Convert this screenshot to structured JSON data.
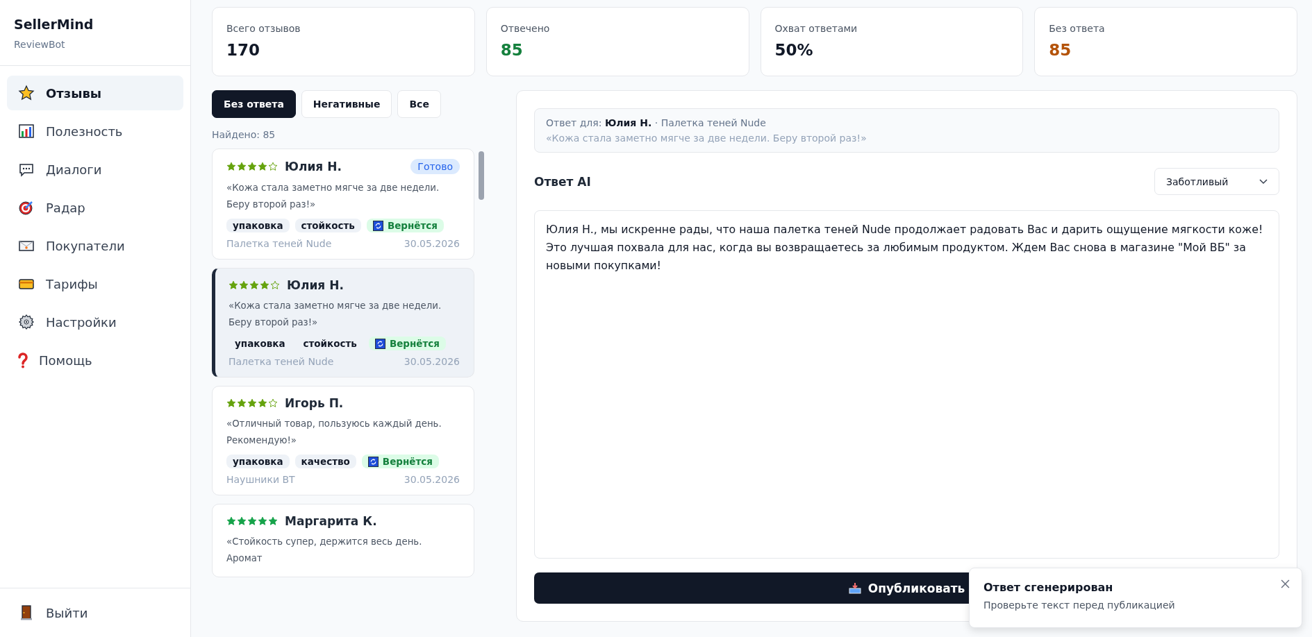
{
  "brand": {
    "title": "SellerMind",
    "subtitle": "ReviewBot"
  },
  "nav": [
    {
      "label": "Отзывы",
      "selected": true
    },
    {
      "label": "Полезность",
      "selected": false
    },
    {
      "label": "Диалоги",
      "selected": false
    },
    {
      "label": "Радар",
      "selected": false
    },
    {
      "label": "Покупатели",
      "selected": false
    },
    {
      "label": "Тарифы",
      "selected": false
    },
    {
      "label": "Настройки",
      "selected": false
    },
    {
      "label": "Помощь",
      "selected": false
    }
  ],
  "logout": {
    "label": "Выйти"
  },
  "stats": [
    {
      "label": "Всего отзывов",
      "value": "170",
      "color": "#111827"
    },
    {
      "label": "Отвечено",
      "value": "85",
      "color": "#15803d"
    },
    {
      "label": "Охват ответами",
      "value": "50%",
      "color": "#111827"
    },
    {
      "label": "Без ответа",
      "value": "85",
      "color": "#b45309"
    }
  ],
  "filters": [
    {
      "label": "Без ответа",
      "selected": true
    },
    {
      "label": "Негативные",
      "selected": false
    },
    {
      "label": "Все",
      "selected": false
    }
  ],
  "found": "Найдено: 85",
  "reviews": [
    {
      "stars": 4,
      "author": "Юлия Н.",
      "badge": "Готово",
      "quote": "«Кожа стала заметно мягче за две недели. Беру второй раз!»",
      "tags": [
        {
          "kind": "tag",
          "label": "упаковка"
        },
        {
          "kind": "tag",
          "label": "стойкость"
        },
        {
          "kind": "returning",
          "label": "Вернётся"
        }
      ],
      "product": "Палетка теней Nude",
      "date": "30.05.2026",
      "selected": false
    },
    {
      "stars": 4,
      "author": "Юлия Н.",
      "quote": "«Кожа стала заметно мягче за две недели. Беру второй раз!»",
      "tags": [
        {
          "kind": "tag",
          "label": "упаковка"
        },
        {
          "kind": "tag",
          "label": "стойкость"
        },
        {
          "kind": "returning",
          "label": "Вернётся"
        }
      ],
      "product": "Палетка теней Nude",
      "date": "30.05.2026",
      "selected": true
    },
    {
      "stars": 4,
      "author": "Игорь П.",
      "quote": "«Отличный товар, пользуюсь каждый день. Рекомендую!»",
      "tags": [
        {
          "kind": "tag",
          "label": "упаковка"
        },
        {
          "kind": "tag",
          "label": "качество"
        },
        {
          "kind": "returning",
          "label": "Вернётся"
        }
      ],
      "product": "Наушники BT",
      "date": "30.05.2026",
      "selected": false
    },
    {
      "stars": 5,
      "author": "Маргарита К.",
      "quote": "«Стойкость супер, держится весь день. Аромат",
      "selected": false
    }
  ],
  "reply": {
    "context": "Ответ для: **Юлия Н.** · Палетка теней Nude",
    "context_quote": "«Кожа стала заметно мягче за две недели. Беру второй раз!»",
    "heading": "Ответ AI",
    "tone": "Заботливый",
    "text": "Юлия Н., мы искренне рады, что наша палетка теней Nude продолжает радовать Вас и дарить ощущение мягкости коже! Это лучшая похвала для нас, когда вы возвращаетесь за любимым продуктом. Ждем Вас снова в магазине \"Мой ВБ\" за новыми покупками!",
    "publish": "Опубликовать"
  },
  "toast": {
    "title": "Ответ сгенерирован",
    "message": "Проверьте текст перед публикацией"
  }
}
